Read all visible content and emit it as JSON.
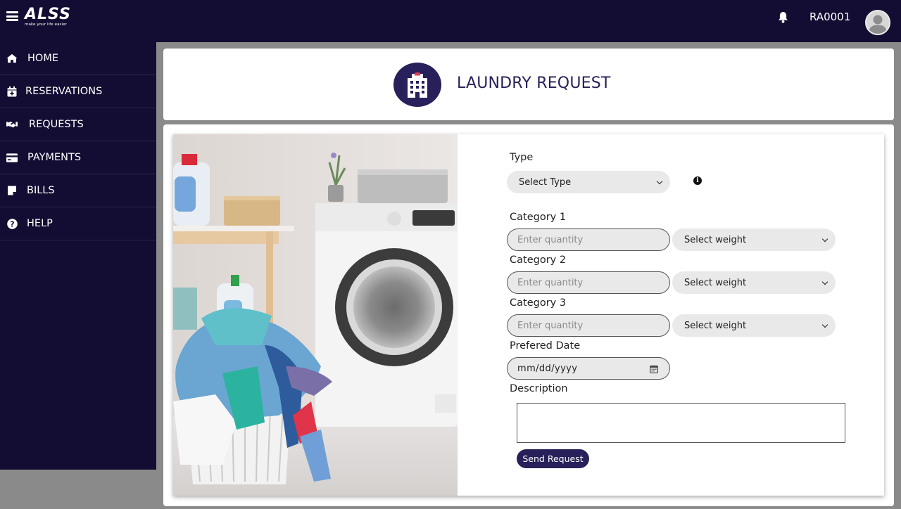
{
  "app": {
    "logo_text": "ALSS",
    "logo_tagline": "make your life easier",
    "user_id": "RA0001"
  },
  "sidebar": {
    "items": [
      {
        "label": "HOME",
        "icon": "home-icon"
      },
      {
        "label": "RESERVATIONS",
        "icon": "calendar-icon"
      },
      {
        "label": "REQUESTS",
        "icon": "handshake-icon"
      },
      {
        "label": "PAYMENTS",
        "icon": "credit-card-icon"
      },
      {
        "label": "BILLS",
        "icon": "note-icon"
      },
      {
        "label": "HELP",
        "icon": "question-circle-icon"
      }
    ]
  },
  "header": {
    "title": "LAUNDRY REQUEST",
    "icon": "building-icon"
  },
  "form": {
    "type_label": "Type",
    "type_select": "Select Type",
    "categories": [
      {
        "label": "Category 1",
        "quantity_placeholder": "Enter quantity",
        "weight_select": "Select weight"
      },
      {
        "label": "Category 2",
        "quantity_placeholder": "Enter quantity",
        "weight_select": "Select weight"
      },
      {
        "label": "Category 3",
        "quantity_placeholder": "Enter quantity",
        "weight_select": "Select weight"
      }
    ],
    "date_label": "Prefered Date",
    "date_placeholder": "mm/dd/yyyy",
    "description_label": "Description",
    "description_value": "",
    "submit_label": "Send Request"
  },
  "colors": {
    "navbar": "#130d33",
    "accent": "#27205a",
    "page_bg": "#8a8a8a"
  }
}
